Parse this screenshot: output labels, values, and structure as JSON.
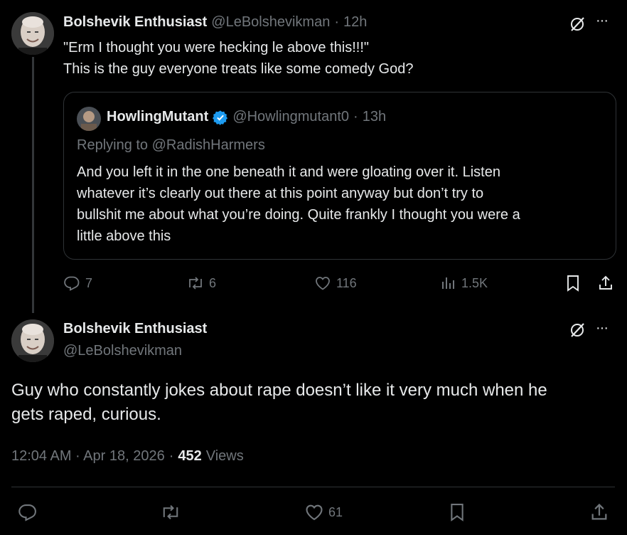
{
  "tweet1": {
    "author_name": "Bolshevik Enthusiast",
    "handle": "@LeBolshevikman",
    "separator": "·",
    "time": "12h",
    "text_line1": "\"Erm I thought you were hecking le above this!!!\"",
    "text_line2": "This is the guy everyone treats like some comedy God?",
    "more_label": "···",
    "quote": {
      "author_name": "HowlingMutant",
      "handle": "@Howlingmutant0",
      "separator": "·",
      "time": "13h",
      "replying_to": "Replying to @RadishHarmers",
      "text_line1": "And you left it in the one beneath it and were gloating over it.  Listen",
      "text_line2": "whatever it’s clearly out there at this point anyway but don’t try to",
      "text_line3": "bullshit me about what you’re doing.  Quite frankly I thought you were a",
      "text_line4": "little above this"
    },
    "actions": {
      "replies": "7",
      "reposts": "6",
      "likes": "116",
      "views": "1.5K"
    }
  },
  "tweet2": {
    "author_name": "Bolshevik Enthusiast",
    "handle": "@LeBolshevikman",
    "more_label": "···",
    "text_line1": "Guy who constantly jokes about rape doesn’t like it very much when he",
    "text_line2": "gets raped, curious.",
    "timestamp": "12:04 AM · Apr 18, 2026",
    "dot": "·",
    "views_count": "452",
    "views_label": "Views",
    "actions": {
      "likes": "61"
    }
  },
  "colors": {
    "background": "#000000",
    "text": "#e7e9ea",
    "muted": "#71767b",
    "border": "#2f3336",
    "verified": "#1d9bf0"
  },
  "icons": [
    "grok-icon",
    "more-icon",
    "verified-icon",
    "reply-icon",
    "repost-icon",
    "like-icon",
    "views-icon",
    "bookmark-icon",
    "share-icon"
  ]
}
